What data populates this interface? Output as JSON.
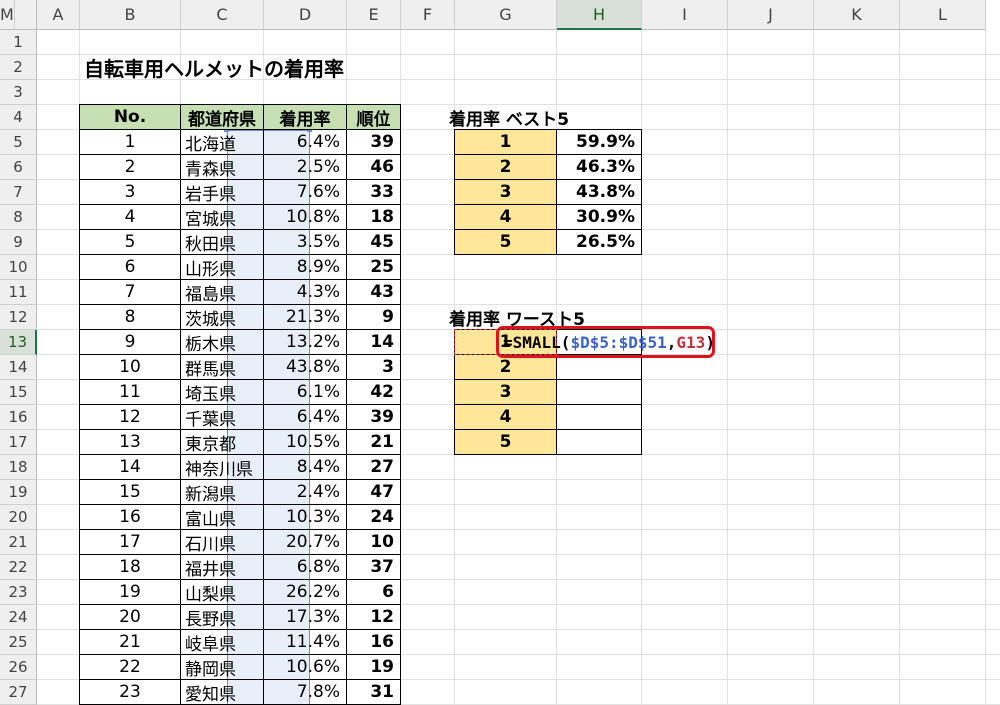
{
  "columns": [
    "A",
    "B",
    "C",
    "D",
    "E",
    "F",
    "G",
    "H",
    "I",
    "J",
    "K",
    "L",
    "M"
  ],
  "rows": [
    "1",
    "2",
    "3",
    "4",
    "5",
    "6",
    "7",
    "8",
    "9",
    "10",
    "11",
    "12",
    "13",
    "14",
    "15",
    "16",
    "17",
    "18",
    "19",
    "20",
    "21",
    "22",
    "23",
    "24",
    "25",
    "26",
    "27"
  ],
  "title": "自転車用ヘルメットの着用率",
  "table": {
    "headers": [
      "No.",
      "都道府県",
      "着用率",
      "順位"
    ],
    "rows": [
      [
        "1",
        "北海道",
        "6.4%",
        "39"
      ],
      [
        "2",
        "青森県",
        "2.5%",
        "46"
      ],
      [
        "3",
        "岩手県",
        "7.6%",
        "33"
      ],
      [
        "4",
        "宮城県",
        "10.8%",
        "18"
      ],
      [
        "5",
        "秋田県",
        "3.5%",
        "45"
      ],
      [
        "6",
        "山形県",
        "8.9%",
        "25"
      ],
      [
        "7",
        "福島県",
        "4.3%",
        "43"
      ],
      [
        "8",
        "茨城県",
        "21.3%",
        "9"
      ],
      [
        "9",
        "栃木県",
        "13.2%",
        "14"
      ],
      [
        "10",
        "群馬県",
        "43.8%",
        "3"
      ],
      [
        "11",
        "埼玉県",
        "6.1%",
        "42"
      ],
      [
        "12",
        "千葉県",
        "6.4%",
        "39"
      ],
      [
        "13",
        "東京都",
        "10.5%",
        "21"
      ],
      [
        "14",
        "神奈川県",
        "8.4%",
        "27"
      ],
      [
        "15",
        "新潟県",
        "2.4%",
        "47"
      ],
      [
        "16",
        "富山県",
        "10.3%",
        "24"
      ],
      [
        "17",
        "石川県",
        "20.7%",
        "10"
      ],
      [
        "18",
        "福井県",
        "6.8%",
        "37"
      ],
      [
        "19",
        "山梨県",
        "26.2%",
        "6"
      ],
      [
        "20",
        "長野県",
        "17.3%",
        "12"
      ],
      [
        "21",
        "岐阜県",
        "11.4%",
        "16"
      ],
      [
        "22",
        "静岡県",
        "10.6%",
        "19"
      ],
      [
        "23",
        "愛知県",
        "7.8%",
        "31"
      ]
    ]
  },
  "best5": {
    "title": "着用率 ベスト5",
    "rows": [
      [
        "1",
        "59.9%"
      ],
      [
        "2",
        "46.3%"
      ],
      [
        "3",
        "43.8%"
      ],
      [
        "4",
        "30.9%"
      ],
      [
        "5",
        "26.5%"
      ]
    ]
  },
  "worst5": {
    "title": "着用率 ワースト5",
    "ranks": [
      "1",
      "2",
      "3",
      "4",
      "5"
    ],
    "formula": {
      "prefix": "=SMALL(",
      "ref1": "$D$5:$D$51",
      "sep": ",",
      "ref2": "G13",
      "suffix": ")"
    }
  },
  "colors": {
    "header_green": "#c6e0b4",
    "rank_yellow": "#ffe699",
    "highlight_red": "#e0121a"
  }
}
